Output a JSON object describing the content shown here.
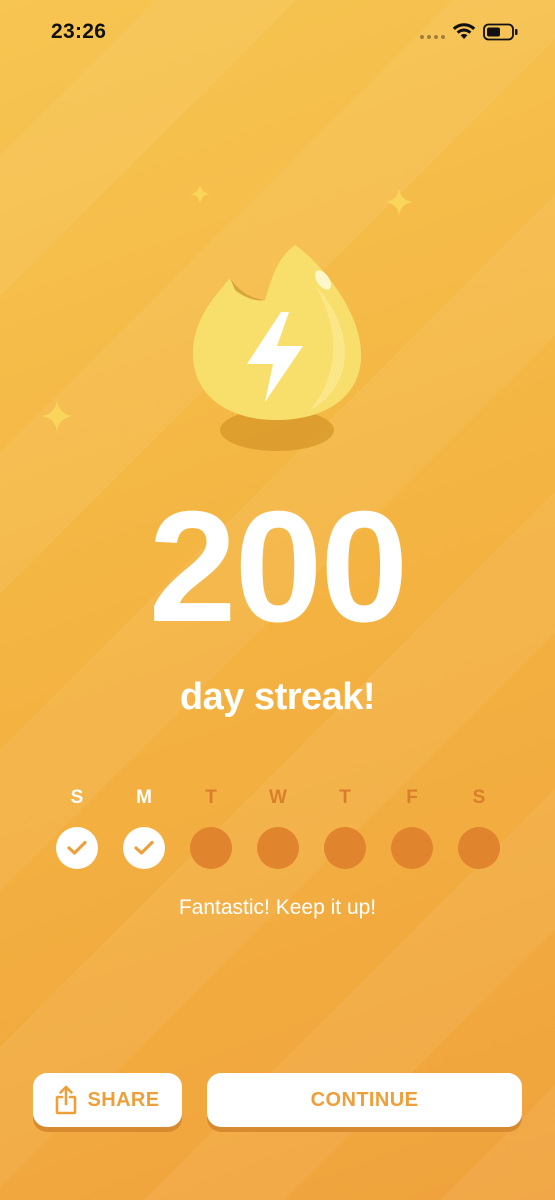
{
  "status_bar": {
    "time": "23:26"
  },
  "streak": {
    "count": "200",
    "label": "day streak!"
  },
  "week": {
    "days": [
      {
        "letter": "S",
        "completed": true
      },
      {
        "letter": "M",
        "completed": true
      },
      {
        "letter": "T",
        "completed": false
      },
      {
        "letter": "W",
        "completed": false
      },
      {
        "letter": "T",
        "completed": false
      },
      {
        "letter": "F",
        "completed": false
      },
      {
        "letter": "S",
        "completed": false
      }
    ]
  },
  "message": "Fantastic! Keep it up!",
  "buttons": {
    "share_label": "SHARE",
    "continue_label": "CONTINUE"
  },
  "icons": {
    "flame": "flame-lightning-icon",
    "share": "share-icon",
    "check": "check-icon",
    "wifi": "wifi-icon",
    "battery": "battery-icon"
  },
  "colors": {
    "background_top": "#f7c552",
    "background_bottom": "#f0a23c",
    "accent_text": "#ef9f3a",
    "future_day": "#e0842e",
    "flame": "#f8df6c"
  }
}
